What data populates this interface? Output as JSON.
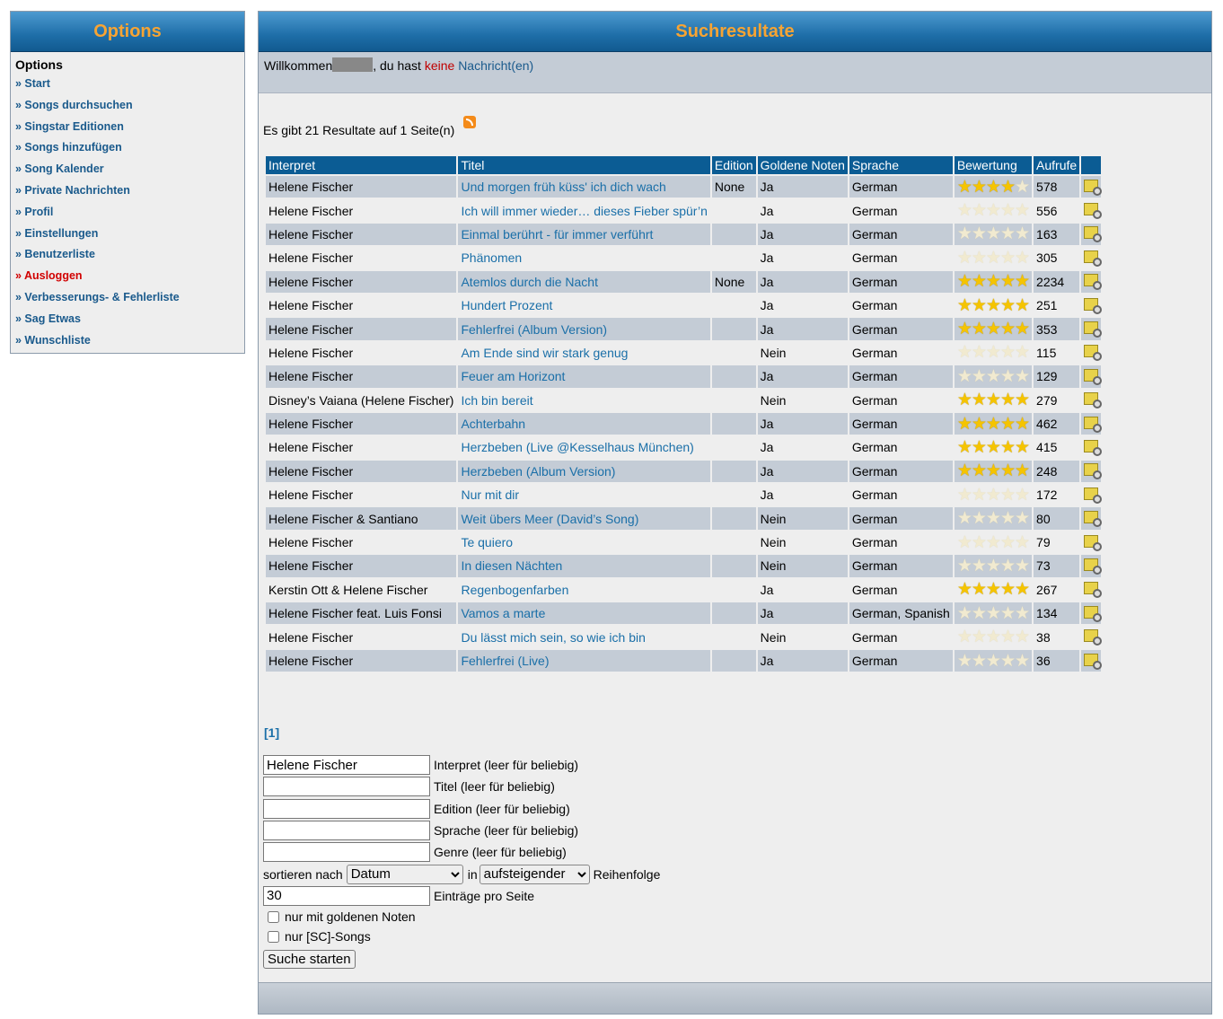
{
  "sidebar": {
    "header": "Options",
    "title": "Options",
    "items": [
      {
        "label": "» Start",
        "red": false
      },
      {
        "label": "» Songs durchsuchen",
        "red": false
      },
      {
        "label": "» Singstar Editionen",
        "red": false
      },
      {
        "label": "» Songs hinzufügen",
        "red": false
      },
      {
        "label": "» Song Kalender",
        "red": false
      },
      {
        "label": "» Private Nachrichten",
        "red": false
      },
      {
        "label": "» Profil",
        "red": false
      },
      {
        "label": "» Einstellungen",
        "red": false
      },
      {
        "label": "» Benutzerliste",
        "red": false
      },
      {
        "label": "» Ausloggen",
        "red": true
      },
      {
        "label": "» Verbesserungs- & Fehlerliste",
        "red": false
      },
      {
        "label": "» Sag Etwas",
        "red": false
      },
      {
        "label": "» Wunschliste",
        "red": false
      }
    ]
  },
  "main": {
    "header": "Suchresultate",
    "welcome_prefix": "Willkommen",
    "welcome_mid": ", du hast ",
    "welcome_none": "keine",
    "welcome_link": "Nachricht(en)",
    "result_count": "Es gibt 21 Resultate auf 1 Seite(n)",
    "rss_icon": "rss-icon"
  },
  "table": {
    "columns": [
      "Interpret",
      "Titel",
      "Edition",
      "Goldene Noten",
      "Sprache",
      "Bewertung",
      "Aufrufe",
      ""
    ],
    "rows": [
      {
        "artist": "Helene Fischer",
        "title": "Und morgen früh küss' ich dich wach",
        "edition": "None",
        "gold": "Ja",
        "lang": "German",
        "rating": 4.5,
        "views": "578"
      },
      {
        "artist": "Helene Fischer",
        "title": "Ich will immer wieder… dieses Fieber spür’n",
        "edition": "",
        "gold": "Ja",
        "lang": "German",
        "rating": 0,
        "views": "556"
      },
      {
        "artist": "Helene Fischer",
        "title": "Einmal berührt - für immer verführt",
        "edition": "",
        "gold": "Ja",
        "lang": "German",
        "rating": 0,
        "views": "163"
      },
      {
        "artist": "Helene Fischer",
        "title": "Phänomen",
        "edition": "",
        "gold": "Ja",
        "lang": "German",
        "rating": 0,
        "views": "305"
      },
      {
        "artist": "Helene Fischer",
        "title": "Atemlos durch die Nacht",
        "edition": "None",
        "gold": "Ja",
        "lang": "German",
        "rating": 5,
        "views": "2234"
      },
      {
        "artist": "Helene Fischer",
        "title": "Hundert Prozent",
        "edition": "",
        "gold": "Ja",
        "lang": "German",
        "rating": 5,
        "views": "251"
      },
      {
        "artist": "Helene Fischer",
        "title": "Fehlerfrei (Album Version)",
        "edition": "",
        "gold": "Ja",
        "lang": "German",
        "rating": 5,
        "views": "353"
      },
      {
        "artist": "Helene Fischer",
        "title": "Am Ende sind wir stark genug",
        "edition": "",
        "gold": "Nein",
        "lang": "German",
        "rating": 0,
        "views": "115"
      },
      {
        "artist": "Helene Fischer",
        "title": "Feuer am Horizont",
        "edition": "",
        "gold": "Ja",
        "lang": "German",
        "rating": 0,
        "views": "129"
      },
      {
        "artist": "Disney’s Vaiana (Helene Fischer)",
        "title": "Ich bin bereit",
        "edition": "",
        "gold": "Nein",
        "lang": "German",
        "rating": 5,
        "views": "279"
      },
      {
        "artist": "Helene Fischer",
        "title": "Achterbahn",
        "edition": "",
        "gold": "Ja",
        "lang": "German",
        "rating": 5,
        "views": "462"
      },
      {
        "artist": "Helene Fischer",
        "title": "Herzbeben (Live @Kesselhaus München)",
        "edition": "",
        "gold": "Ja",
        "lang": "German",
        "rating": 5,
        "views": "415"
      },
      {
        "artist": "Helene Fischer",
        "title": "Herzbeben (Album Version)",
        "edition": "",
        "gold": "Ja",
        "lang": "German",
        "rating": 5,
        "views": "248"
      },
      {
        "artist": "Helene Fischer",
        "title": "Nur mit dir",
        "edition": "",
        "gold": "Ja",
        "lang": "German",
        "rating": 0,
        "views": "172"
      },
      {
        "artist": "Helene Fischer & Santiano",
        "title": "Weit übers Meer (David’s Song)",
        "edition": "",
        "gold": "Nein",
        "lang": "German",
        "rating": 0,
        "views": "80"
      },
      {
        "artist": "Helene Fischer",
        "title": "Te quiero",
        "edition": "",
        "gold": "Nein",
        "lang": "German",
        "rating": 0,
        "views": "79"
      },
      {
        "artist": "Helene Fischer",
        "title": "In diesen Nächten",
        "edition": "",
        "gold": "Nein",
        "lang": "German",
        "rating": 0,
        "views": "73"
      },
      {
        "artist": "Kerstin Ott & Helene Fischer",
        "title": "Regenbogenfarben",
        "edition": "",
        "gold": "Ja",
        "lang": "German",
        "rating": 5,
        "views": "267"
      },
      {
        "artist": "Helene Fischer feat. Luis Fonsi",
        "title": "Vamos a marte",
        "edition": "",
        "gold": "Ja",
        "lang": "German, Spanish",
        "rating": 0,
        "views": "134"
      },
      {
        "artist": "Helene Fischer",
        "title": "Du lässt mich sein, so wie ich bin",
        "edition": "",
        "gold": "Nein",
        "lang": "German",
        "rating": 0,
        "views": "38"
      },
      {
        "artist": "Helene Fischer",
        "title": "Fehlerfrei (Live)",
        "edition": "",
        "gold": "Ja",
        "lang": "German",
        "rating": 0,
        "views": "36"
      }
    ]
  },
  "pager": "[1]",
  "form": {
    "artist_value": "Helene Fischer",
    "artist_label": "Interpret (leer für beliebig)",
    "title_label": "Titel (leer für beliebig)",
    "edition_label": "Edition (leer für beliebig)",
    "lang_label": "Sprache (leer für beliebig)",
    "genre_label": "Genre (leer für beliebig)",
    "sort_label": "sortieren nach",
    "sort_value": "Datum",
    "in_label": "in",
    "order_value": "aufsteigender",
    "order_suffix": "Reihenfolge",
    "per_page_value": "30",
    "per_page_label": "Einträge pro Seite",
    "gold_only_label": "nur mit goldenen Noten",
    "sc_only_label": "nur [SC]-Songs",
    "submit_label": "Suche starten"
  }
}
